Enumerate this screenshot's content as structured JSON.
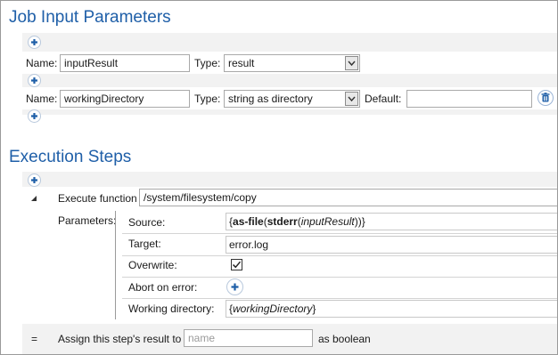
{
  "job_input": {
    "title": "Job Input Parameters",
    "params": [
      {
        "name_label": "Name:",
        "name_value": "inputResult",
        "type_label": "Type:",
        "type_value": "result"
      },
      {
        "name_label": "Name:",
        "name_value": "workingDirectory",
        "type_label": "Type:",
        "type_value": "string as directory",
        "default_label": "Default:",
        "default_value": ""
      }
    ]
  },
  "execution": {
    "title": "Execution Steps",
    "execute_label": "Execute function",
    "function_value": "/system/filesystem/copy",
    "parameters_label": "Parameters:",
    "rows": {
      "source": {
        "label": "Source:",
        "open": "{",
        "fn1": "as-file",
        "p1": "(",
        "fn2": "stderr",
        "p2": "(",
        "var": "inputResult",
        "close": "))}"
      },
      "target": {
        "label": "Target:",
        "value": "error.log"
      },
      "overwrite": {
        "label": "Overwrite:",
        "checked": true
      },
      "abort": {
        "label": "Abort on error:"
      },
      "workdir": {
        "label": "Working directory:",
        "open": "{",
        "var": "workingDirectory",
        "close": "}"
      }
    },
    "assign": {
      "eq": "=",
      "label": "Assign this step's result to",
      "placeholder": "name",
      "suffix": "as boolean"
    }
  },
  "icons": {
    "add": "plus-icon",
    "delete": "trash-icon",
    "expand": "triangle-expanded-icon",
    "dropdown": "chevron-down-icon",
    "check": "checkmark-icon"
  },
  "colors": {
    "accent": "#1f5fa8",
    "band": "#f2f2f2"
  }
}
